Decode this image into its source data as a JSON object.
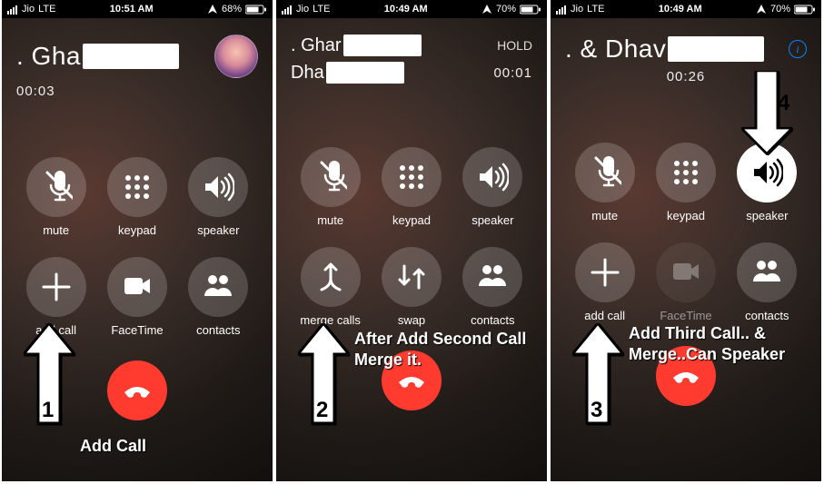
{
  "screens": {
    "s1": {
      "status": {
        "carrier": "Jio",
        "network": "LTE",
        "time": "10:51 AM",
        "battery": "68%"
      },
      "caller1": ". Gha",
      "timer": "00:03",
      "buttons": {
        "mute": "mute",
        "keypad": "keypad",
        "speaker": "speaker",
        "addcall": "add call",
        "facetime": "FaceTime",
        "contacts": "contacts"
      },
      "step": "1",
      "caption": "Add Call"
    },
    "s2": {
      "status": {
        "carrier": "Jio",
        "network": "LTE",
        "time": "10:49 AM",
        "battery": "70%"
      },
      "caller1": ". Ghar",
      "hold": "HOLD",
      "caller2": "Dha",
      "timer": "00:01",
      "buttons": {
        "mute": "mute",
        "keypad": "keypad",
        "speaker": "speaker",
        "merge": "merge calls",
        "swap": "swap",
        "contacts": "contacts"
      },
      "step": "2",
      "caption": "After Add Second Call Merge it."
    },
    "s3": {
      "status": {
        "carrier": "Jio",
        "network": "LTE",
        "time": "10:49 AM",
        "battery": "70%"
      },
      "caller1": ". & Dhav",
      "timer": "00:26",
      "buttons": {
        "mute": "mute",
        "keypad": "keypad",
        "speaker": "speaker",
        "addcall": "add call",
        "facetime": "FaceTime",
        "contacts": "contacts"
      },
      "step": "3",
      "step4": "4",
      "caption": "Add Third Call.. & Merge..Can Speaker"
    }
  }
}
